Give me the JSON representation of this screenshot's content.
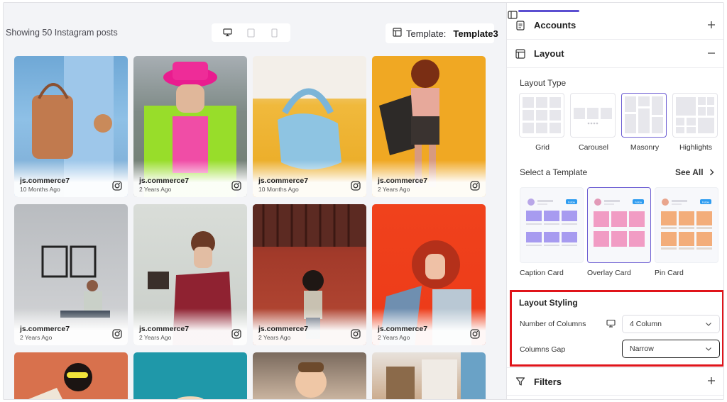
{
  "preview": {
    "showing_text": "Showing 50 Instagram posts",
    "template_label": "Template:",
    "template_value": "Template3",
    "posts": [
      {
        "user": "js.commerce7",
        "time": "10 Months Ago"
      },
      {
        "user": "js.commerce7",
        "time": "2 Years Ago"
      },
      {
        "user": "js.commerce7",
        "time": "10 Months Ago"
      },
      {
        "user": "js.commerce7",
        "time": "2 Years Ago"
      },
      {
        "user": "js.commerce7",
        "time": "2 Years Ago"
      },
      {
        "user": "js.commerce7",
        "time": "2 Years Ago"
      },
      {
        "user": "js.commerce7",
        "time": "2 Years Ago"
      },
      {
        "user": "js.commerce7",
        "time": "2 Years Ago"
      }
    ]
  },
  "panel": {
    "accounts": "Accounts",
    "layout": "Layout",
    "layout_type_label": "Layout Type",
    "layout_types": [
      "Grid",
      "Carousel",
      "Masonry",
      "Highlights"
    ],
    "select_template_label": "Select a Template",
    "see_all": "See All",
    "templates": [
      "Caption Card",
      "Overlay Card",
      "Pin Card"
    ],
    "styling_title": "Layout Styling",
    "columns_label": "Number of Columns",
    "columns_value": "4 Column",
    "gap_label": "Columns Gap",
    "gap_value": "Narrow",
    "filters": "Filters",
    "follow_badge": "Follow"
  },
  "colors": {
    "accent": "#5b4fd1",
    "highlight_border": "#e0141a"
  }
}
